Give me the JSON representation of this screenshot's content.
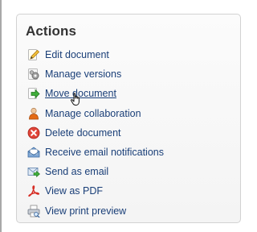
{
  "panel": {
    "title": "Actions"
  },
  "actions": [
    {
      "label": "Edit document",
      "icon": "pencil-icon"
    },
    {
      "label": "Manage versions",
      "icon": "gears-icon"
    },
    {
      "label": "Move document",
      "icon": "move-arrow-icon",
      "hovered": true
    },
    {
      "label": "Manage collaboration",
      "icon": "person-icon"
    },
    {
      "label": "Delete document",
      "icon": "delete-icon"
    },
    {
      "label": "Receive email notifications",
      "icon": "envelope-icon"
    },
    {
      "label": "Send as email",
      "icon": "send-mail-icon"
    },
    {
      "label": "View as PDF",
      "icon": "pdf-icon"
    },
    {
      "label": "View print preview",
      "icon": "print-preview-icon"
    }
  ],
  "colors": {
    "link": "#1a3f78",
    "title": "#333333",
    "panel_border": "#d2d2d2"
  }
}
